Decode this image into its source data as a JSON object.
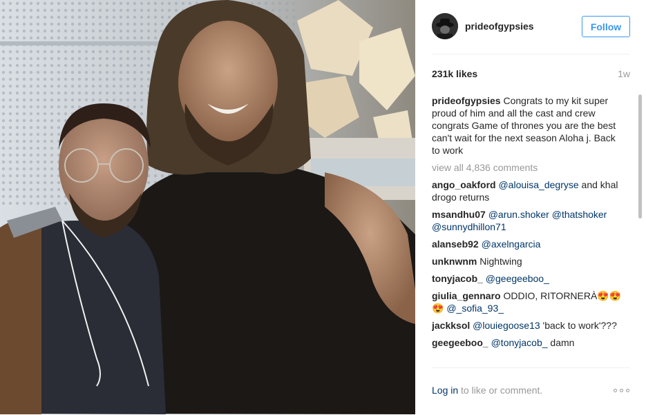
{
  "post": {
    "username": "prideofgypsies",
    "follow_label": "Follow",
    "likes": "231k likes",
    "time_ago": "1w",
    "caption_user": "prideofgypsies",
    "caption_text": " Congrats to my kit super proud of him and all the cast and crew congrats Game of thrones you are the best can't wait for the next season Aloha j. Back to work",
    "view_all": "view all 4,836 comments"
  },
  "comments": [
    {
      "user": "ango_oakford",
      "parts": [
        {
          "t": "m",
          "v": "@alouisa_degryse"
        },
        {
          "t": "x",
          "v": " and khal drogo returns"
        }
      ]
    },
    {
      "user": "msandhu07",
      "parts": [
        {
          "t": "m",
          "v": "@arun.shoker"
        },
        {
          "t": "x",
          "v": " "
        },
        {
          "t": "m",
          "v": "@thatshoker"
        },
        {
          "t": "x",
          "v": " "
        },
        {
          "t": "m",
          "v": "@sunnydhillon71"
        }
      ]
    },
    {
      "user": "alanseb92",
      "parts": [
        {
          "t": "m",
          "v": "@axelngarcia"
        }
      ]
    },
    {
      "user": "unknwnm",
      "parts": [
        {
          "t": "x",
          "v": "Nightwing"
        }
      ]
    },
    {
      "user": "tonyjacob_",
      "parts": [
        {
          "t": "m",
          "v": "@geegeeboo_"
        }
      ]
    },
    {
      "user": "giulia_gennaro",
      "parts": [
        {
          "t": "x",
          "v": "ODDIO, RITORNERÀ😍😍😍 "
        },
        {
          "t": "m",
          "v": "@_sofia_93_"
        }
      ]
    },
    {
      "user": "jackksol",
      "parts": [
        {
          "t": "m",
          "v": "@louiegoose13"
        },
        {
          "t": "x",
          "v": " 'back to work'???"
        }
      ]
    },
    {
      "user": "geegeeboo_",
      "parts": [
        {
          "t": "m",
          "v": "@tonyjacob_"
        },
        {
          "t": "x",
          "v": " damn"
        }
      ]
    }
  ],
  "footer": {
    "login_label": "Log in",
    "login_suffix": " to like or comment."
  },
  "icons": {
    "more": "more-options-icon",
    "avatar": "profile-avatar"
  },
  "colors": {
    "follow_blue": "#3897f0",
    "mention_blue": "#003569",
    "muted_gray": "#999999"
  }
}
